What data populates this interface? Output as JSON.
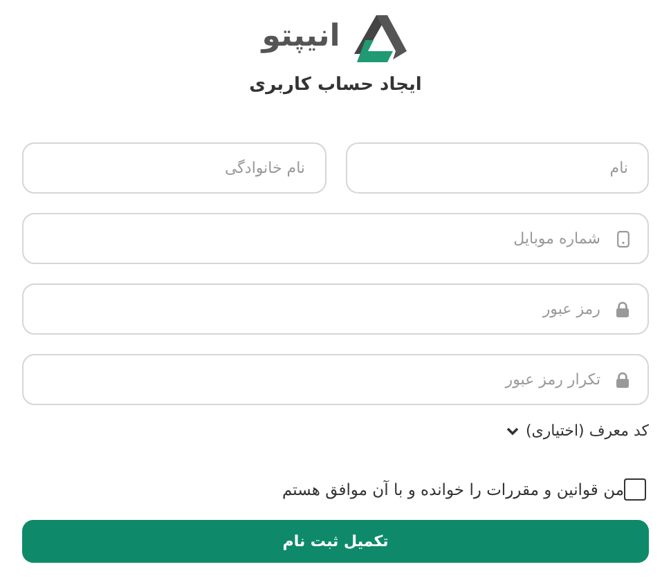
{
  "logo": {
    "text": "انیپتو"
  },
  "title": "ایجاد حساب کاربری",
  "name_row": [
    {
      "placeholder": "نام"
    },
    {
      "placeholder": "نام خانوادگی"
    }
  ],
  "fields": [
    {
      "placeholder": "شماره موبایل",
      "kind": "mobile"
    },
    {
      "placeholder": "رمز عبور",
      "kind": "password"
    },
    {
      "placeholder": "تکرار رمز عبور",
      "kind": "password"
    }
  ],
  "referral": {
    "label": "کد معرف (اختیاری)",
    "expanded": false
  },
  "terms": {
    "label": "من قوانین و مقررات را خوانده و با آن موافق هستم",
    "checked": false
  },
  "submit": "تکمیل ثبت نام"
}
